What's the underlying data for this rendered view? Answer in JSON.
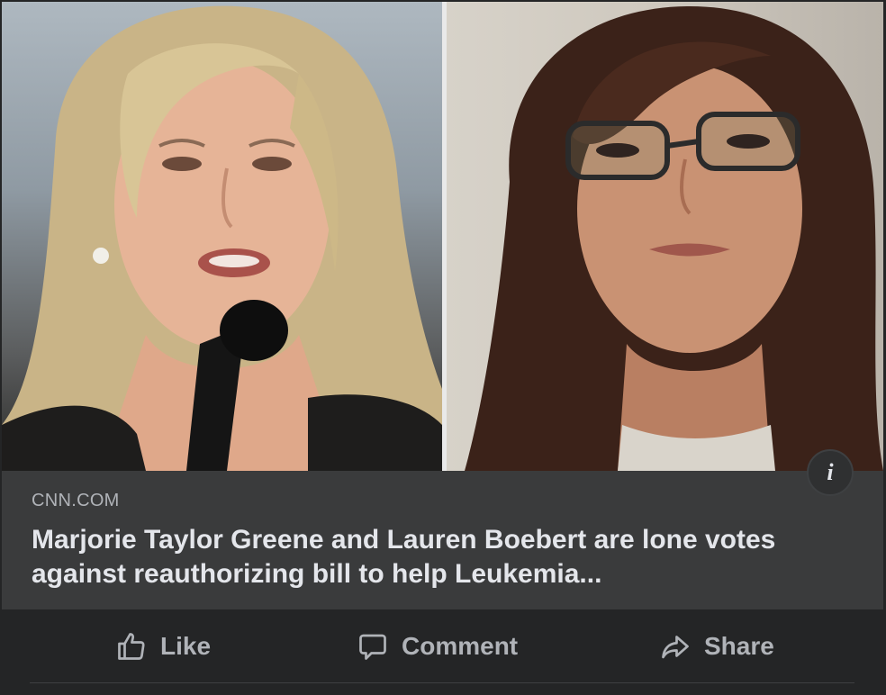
{
  "post": {
    "image_alt": "Marjorie Taylor Greene and Lauren Boebert",
    "info_button_label": "i"
  },
  "link_preview": {
    "domain": "CNN.COM",
    "headline": "Marjorie Taylor Greene and Lauren Boebert are lone votes against reauthorizing bill to help Leukemia..."
  },
  "actions": {
    "like": {
      "label": "Like",
      "icon": "thumbs-up-icon"
    },
    "comment": {
      "label": "Comment",
      "icon": "speech-bubble-icon"
    },
    "share": {
      "label": "Share",
      "icon": "share-arrow-icon"
    }
  },
  "colors": {
    "background": "#242526",
    "preview_background": "#3a3b3c",
    "text_primary": "#e4e6eb",
    "text_secondary": "#b0b3b8"
  }
}
